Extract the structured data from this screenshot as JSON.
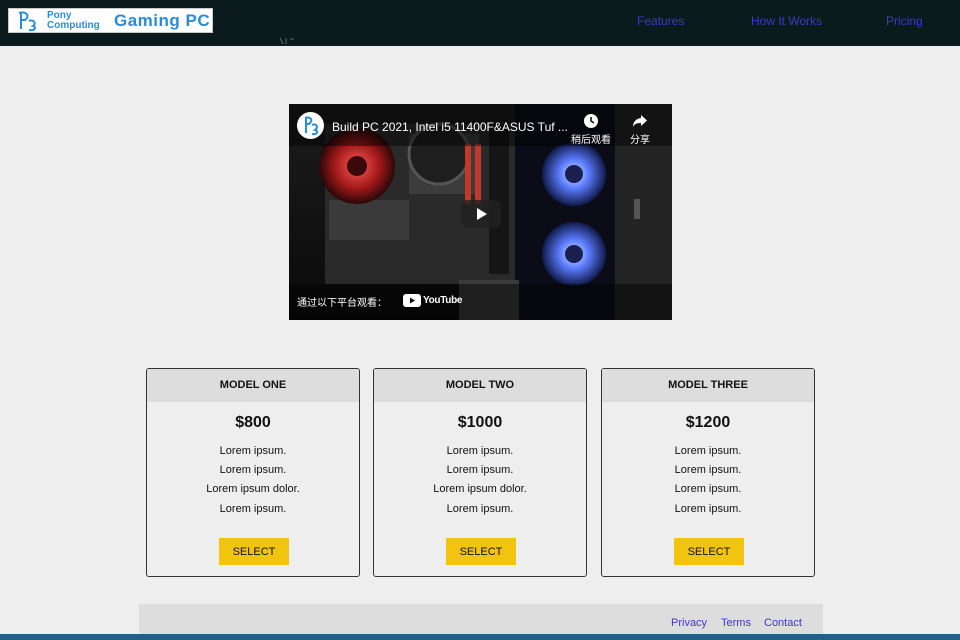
{
  "header": {
    "logo": {
      "line1": "Pony",
      "line2": "Computing",
      "title": "Gaming PC"
    },
    "nav": [
      {
        "label": "Features"
      },
      {
        "label": "How It Works"
      },
      {
        "label": "Pricing"
      }
    ]
  },
  "video": {
    "title": "Build PC 2021, Intel i5 11400F&ASUS Tuf ...",
    "watch_later": "稍后观看",
    "share": "分享",
    "watch_on": "通过以下平台观看：",
    "brand": "YouTube"
  },
  "pricing": {
    "select_label": "SELECT",
    "cards": [
      {
        "name": "MODEL ONE",
        "price": "$800",
        "features": [
          "Lorem ipsum.",
          "Lorem ipsum.",
          "Lorem ipsum dolor.",
          "Lorem ipsum."
        ]
      },
      {
        "name": "MODEL TWO",
        "price": "$1000",
        "features": [
          "Lorem ipsum.",
          "Lorem ipsum.",
          "Lorem ipsum dolor.",
          "Lorem ipsum."
        ]
      },
      {
        "name": "MODEL THREE",
        "price": "$1200",
        "features": [
          "Lorem ipsum.",
          "Lorem ipsum.",
          "Lorem ipsum.",
          "Lorem ipsum."
        ]
      }
    ]
  },
  "footer": {
    "links": [
      {
        "label": "Privacy"
      },
      {
        "label": "Terms"
      },
      {
        "label": "Contact"
      }
    ]
  },
  "colors": {
    "header_bg": "#0b1a1c",
    "link": "#3f37c9",
    "button": "#f1c40f",
    "logo_blue": "#2a8cd8"
  }
}
